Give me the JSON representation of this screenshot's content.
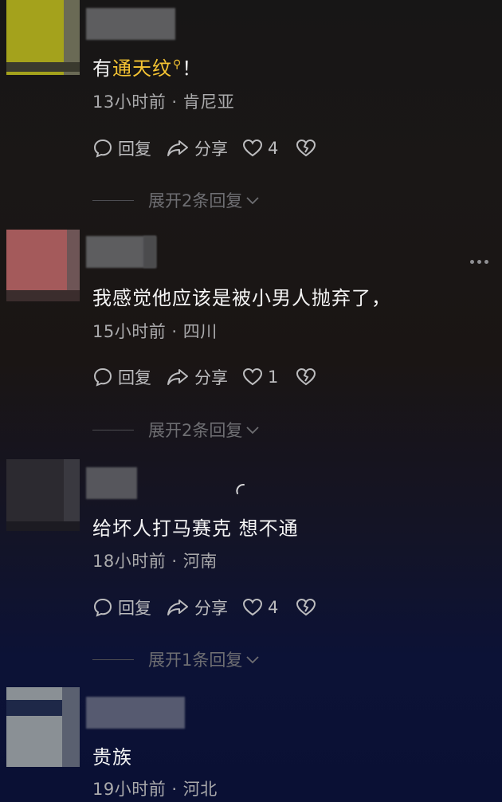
{
  "comments": [
    {
      "text_prefix": "有",
      "highlight": "通天纹",
      "text_suffix": "！",
      "meta": "13小时前 · 肯尼亚",
      "reply_label": "回复",
      "share_label": "分享",
      "like_count": "4",
      "expand_label": "展开2条回复"
    },
    {
      "text": "我感觉他应该是被小男人抛弃了，",
      "meta": "15小时前 · 四川",
      "reply_label": "回复",
      "share_label": "分享",
      "like_count": "1",
      "expand_label": "展开2条回复"
    },
    {
      "text": "给坏人打马赛克 想不通",
      "meta": "18小时前 · 河南",
      "reply_label": "回复",
      "share_label": "分享",
      "like_count": "4",
      "expand_label": "展开1条回复"
    },
    {
      "text": "贵族",
      "meta": "19小时前 · 河北"
    }
  ],
  "colors": {
    "highlight": "#f5c433",
    "text": "#f4f4f4",
    "meta": "#a9a9ab",
    "action": "#bcbcbe",
    "expand": "#6e6e72"
  },
  "icons": [
    "comment-bubble-icon",
    "share-arrow-icon",
    "heart-icon",
    "broken-heart-icon",
    "chevron-down-icon",
    "search-icon",
    "more-icon",
    "loading-spinner-icon"
  ]
}
